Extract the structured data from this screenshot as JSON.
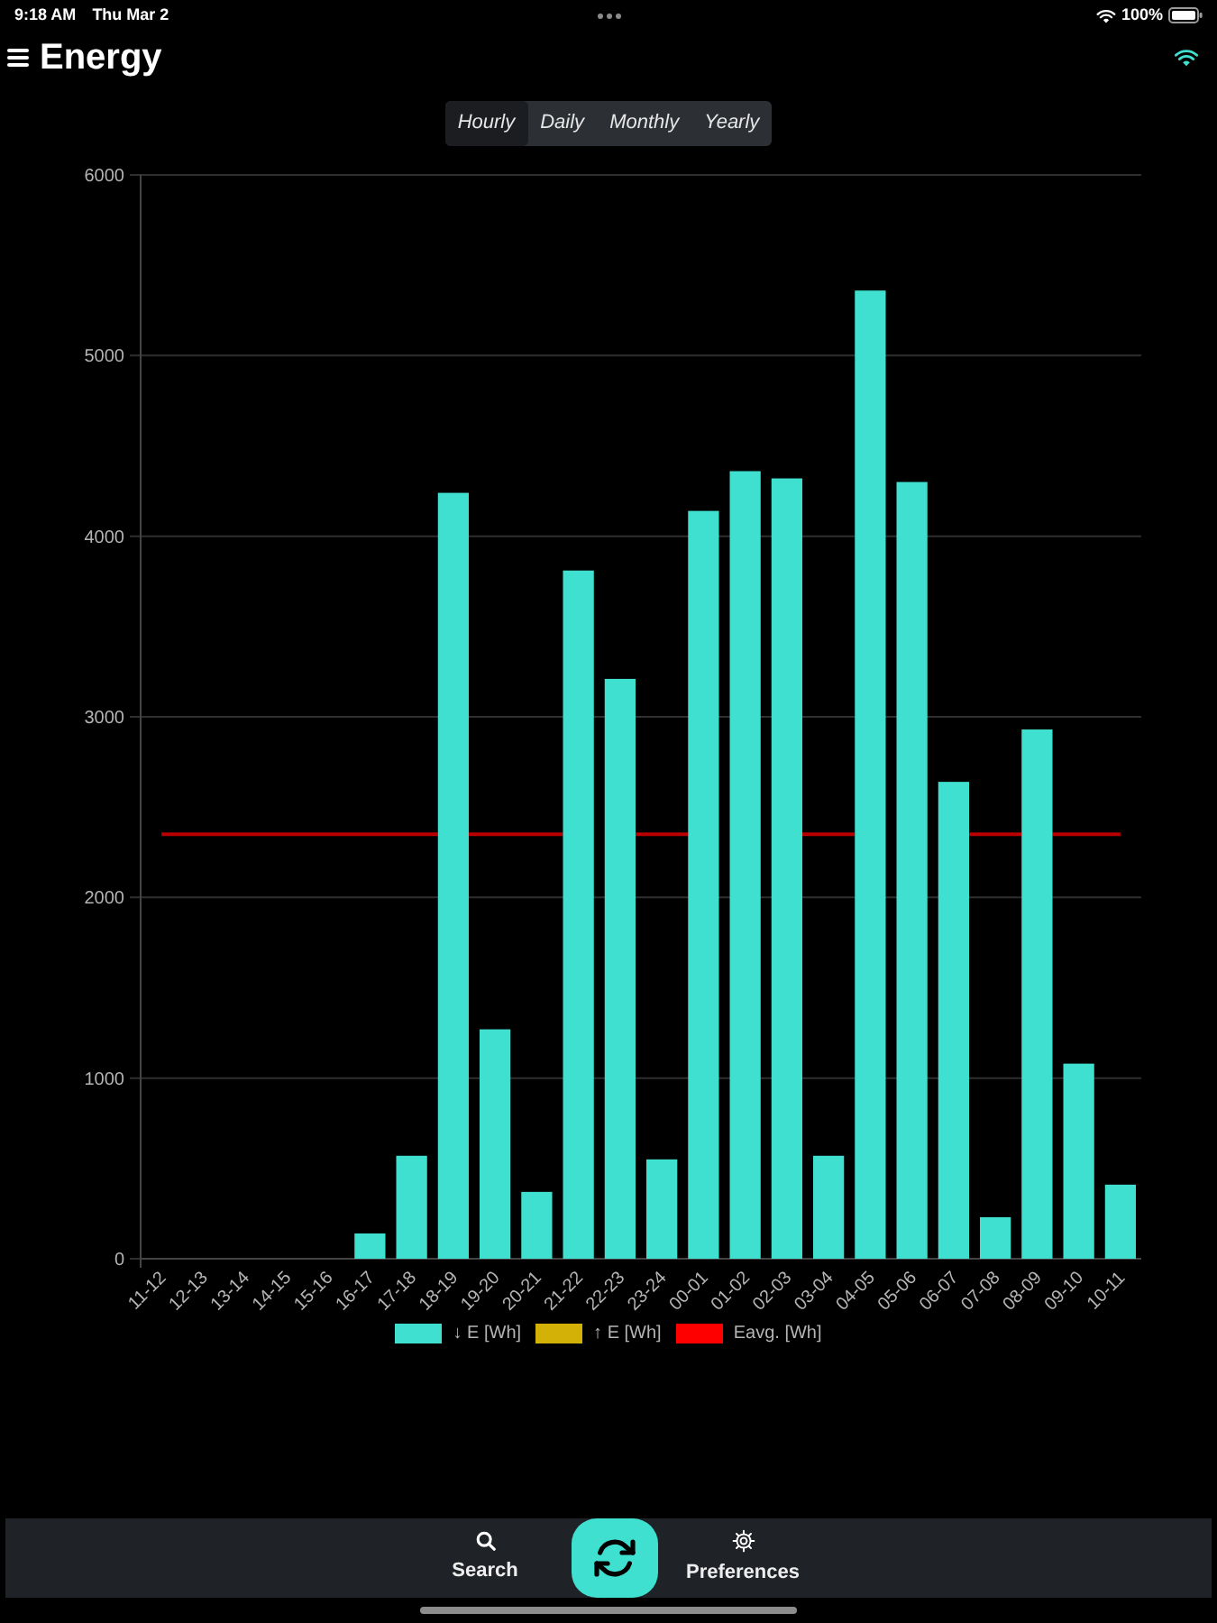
{
  "status_bar": {
    "time": "9:18 AM",
    "date": "Thu Mar 2",
    "battery": "100%"
  },
  "header": {
    "title": "Energy"
  },
  "range_tabs": [
    {
      "label": "Hourly",
      "selected": true
    },
    {
      "label": "Daily",
      "selected": false
    },
    {
      "label": "Monthly",
      "selected": false
    },
    {
      "label": "Yearly",
      "selected": false
    }
  ],
  "chart": {
    "chart_data": {
      "type": "bar",
      "categories": [
        "11-12",
        "12-13",
        "13-14",
        "14-15",
        "15-16",
        "16-17",
        "17-18",
        "18-19",
        "19-20",
        "20-21",
        "21-22",
        "22-23",
        "23-24",
        "00-01",
        "01-02",
        "02-03",
        "03-04",
        "04-05",
        "05-06",
        "06-07",
        "07-08",
        "08-09",
        "09-10",
        "10-11"
      ],
      "series": [
        {
          "name": "↓ E [Wh]",
          "color": "#40e0d0",
          "values": [
            0,
            0,
            0,
            0,
            0,
            140,
            570,
            4240,
            1270,
            370,
            3810,
            3210,
            550,
            4140,
            4360,
            4320,
            570,
            5360,
            4300,
            2640,
            230,
            2930,
            1080,
            410
          ]
        },
        {
          "name": "↑ E [Wh]",
          "color": "#d4b106",
          "values": [
            null,
            null,
            null,
            null,
            null,
            null,
            null,
            null,
            null,
            null,
            null,
            null,
            null,
            null,
            null,
            null,
            null,
            null,
            null,
            null,
            null,
            null,
            null,
            null
          ]
        },
        {
          "name": "Eavg. [Wh]",
          "color": "#ff0000",
          "type": "line",
          "values": [
            2350,
            2350,
            2350,
            2350,
            2350,
            2350,
            2350,
            null,
            2350,
            2350,
            null,
            null,
            2350,
            null,
            null,
            null,
            2350,
            null,
            null,
            null,
            2350,
            null,
            2350,
            2350
          ]
        }
      ],
      "ylim": [
        0,
        6000
      ],
      "yticks": [
        0,
        1000,
        2000,
        3000,
        4000,
        5000,
        6000
      ],
      "stacked": true,
      "grid": true
    }
  },
  "bottom_bar": {
    "items": [
      {
        "kind": "search",
        "label": "Search"
      },
      {
        "kind": "refresh"
      },
      {
        "kind": "settings",
        "label": "Preferences"
      }
    ]
  }
}
